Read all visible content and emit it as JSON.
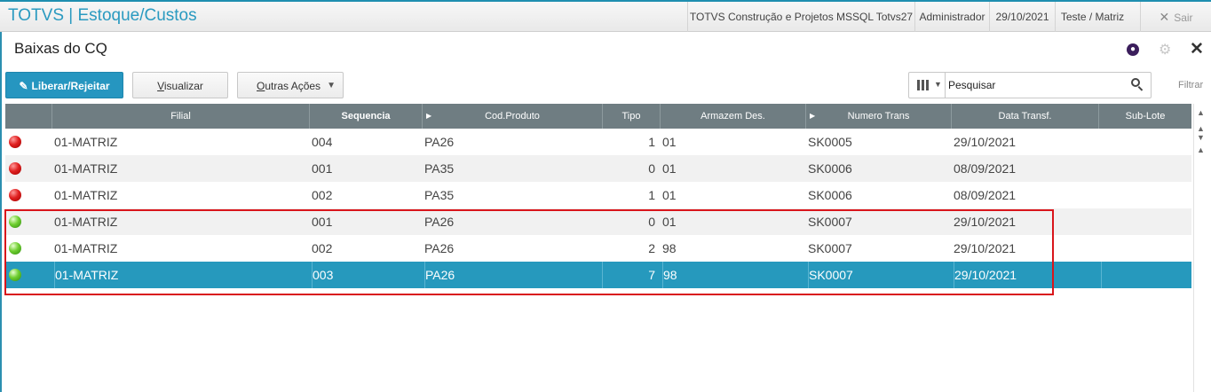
{
  "app": {
    "title": "TOTVS | Estoque/Custos",
    "environment": "TOTVS Construção e Projetos MSSQL Totvs27",
    "user": "Administrador",
    "date": "29/10/2021",
    "branch": "Teste / Matriz",
    "exit_label": "Sair"
  },
  "page": {
    "title": "Baixas do CQ"
  },
  "toolbar": {
    "release_label": "Liberar/Rejeitar",
    "view_label_first": "V",
    "view_label_rest": "isualizar",
    "more_label_first": "O",
    "more_label_rest": "utras Ações"
  },
  "search": {
    "placeholder": "Pesquisar",
    "filter_label": "Filtrar"
  },
  "grid": {
    "columns": [
      "Filial",
      "Sequencia",
      "Cod.Produto",
      "Tipo",
      "Armazem Des.",
      "Numero Trans",
      "Data Transf.",
      "Sub-Lote"
    ],
    "rows": [
      {
        "status": "red",
        "filial": "01-MATRIZ",
        "sequencia": "004",
        "produto": "PA26",
        "tipo": "1",
        "armazem": "01",
        "numero": "SK0005",
        "data": "29/10/2021",
        "sublote": ""
      },
      {
        "status": "red",
        "filial": "01-MATRIZ",
        "sequencia": "001",
        "produto": "PA35",
        "tipo": "0",
        "armazem": "01",
        "numero": "SK0006",
        "data": "08/09/2021",
        "sublote": ""
      },
      {
        "status": "red",
        "filial": "01-MATRIZ",
        "sequencia": "002",
        "produto": "PA35",
        "tipo": "1",
        "armazem": "01",
        "numero": "SK0006",
        "data": "08/09/2021",
        "sublote": ""
      },
      {
        "status": "green",
        "filial": "01-MATRIZ",
        "sequencia": "001",
        "produto": "PA26",
        "tipo": "0",
        "armazem": "01",
        "numero": "SK0007",
        "data": "29/10/2021",
        "sublote": ""
      },
      {
        "status": "green",
        "filial": "01-MATRIZ",
        "sequencia": "002",
        "produto": "PA26",
        "tipo": "2",
        "armazem": "98",
        "numero": "SK0007",
        "data": "29/10/2021",
        "sublote": ""
      },
      {
        "status": "green",
        "filial": "01-MATRIZ",
        "sequencia": "003",
        "produto": "PA26",
        "tipo": "7",
        "armazem": "98",
        "numero": "SK0007",
        "data": "29/10/2021",
        "sublote": ""
      }
    ],
    "selected_row": 5
  },
  "colors": {
    "accent": "#2696c0",
    "header_bg": "#6f7d82",
    "status_red": "#e02020",
    "status_green": "#6fcf30",
    "highlight_border": "#d9151b"
  }
}
